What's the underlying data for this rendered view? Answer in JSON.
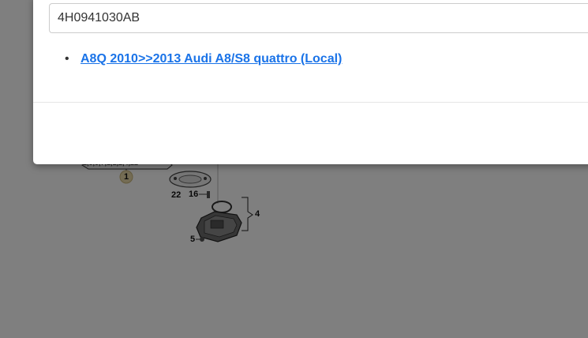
{
  "search": {
    "value": "4H0941030AB"
  },
  "results": [
    {
      "label": "A8Q 2010>>2013 Audi A8/S8 quattro (Local)"
    }
  ],
  "diagram": {
    "callouts": {
      "c1": "1",
      "c22": "22",
      "c16": "16",
      "c4": "4",
      "c5": "5"
    },
    "strip_text": "2,3,5,7,1,1,2,4,22"
  }
}
